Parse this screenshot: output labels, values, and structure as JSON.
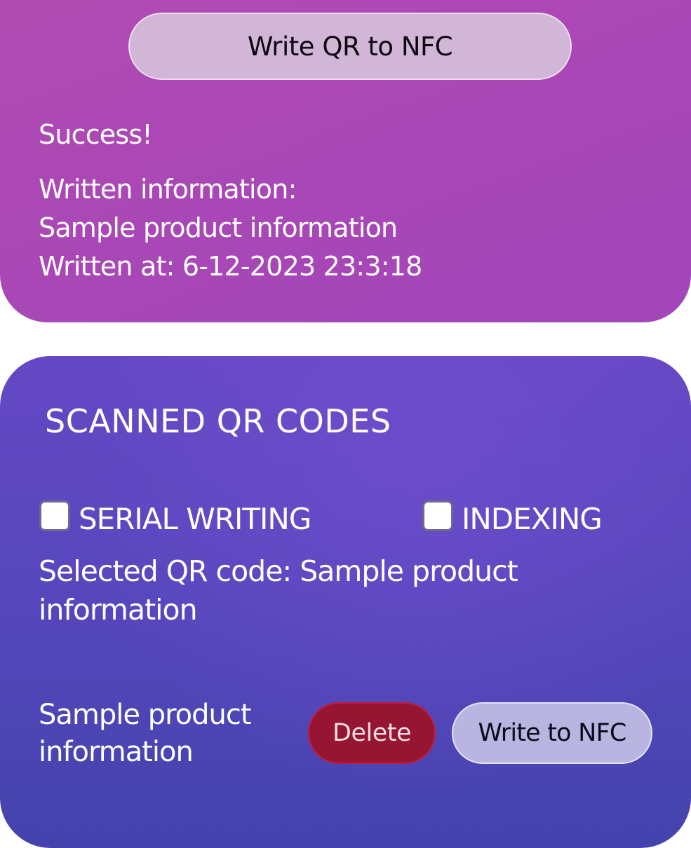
{
  "top_card": {
    "write_qr_button_label": "Write QR to NFC",
    "status": "Success!",
    "written_information_label": "Written information:",
    "written_information_value": "Sample product information",
    "written_at": "Written at: 6-12-2023 23:3:18"
  },
  "scanned_section": {
    "title": "SCANNED QR CODES",
    "options": {
      "serial_writing": {
        "label": "SERIAL WRITING",
        "checked": false
      },
      "indexing": {
        "label": "INDEXING",
        "checked": false
      }
    },
    "selected_qr_code": "Selected QR code: Sample product information",
    "items": [
      {
        "text": "Sample product information",
        "delete_label": "Delete",
        "write_label": "Write to NFC"
      }
    ]
  },
  "colors": {
    "top_card_bg": "#a947b6",
    "bottom_card_bg": "#5747bd",
    "delete_button_bg": "#951533",
    "write_button_bg": "#b9b5e0",
    "primary_button_bg": "#d2b6d8"
  }
}
